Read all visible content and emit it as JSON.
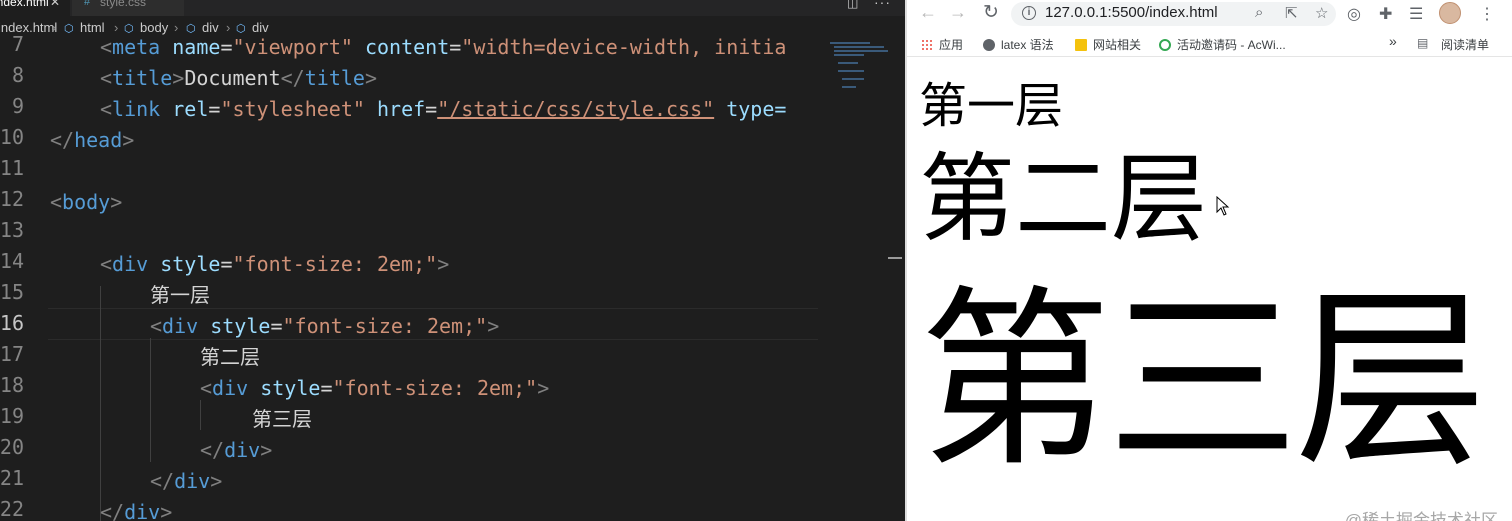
{
  "editor": {
    "tabs": [
      {
        "label": "index.html",
        "icon": "close-icon"
      },
      {
        "label": "style.css",
        "icon": "css-hash-icon"
      }
    ],
    "breadcrumb": [
      "index.html",
      "html",
      "body",
      "div",
      "div"
    ],
    "line_numbers": [
      "7",
      "8",
      "9",
      "10",
      "11",
      "12",
      "13",
      "14",
      "15",
      "16",
      "17",
      "18",
      "19",
      "20",
      "21",
      "22"
    ],
    "active_line": "16",
    "lines": {
      "l7": {
        "tag": "meta",
        "a1": "name",
        "v1": "\"viewport\"",
        "a2": "content",
        "v2": "\"width=device-width, initia"
      },
      "l8": {
        "open": "title",
        "text": "Document",
        "close": "title"
      },
      "l9": {
        "tag": "link",
        "a1": "rel",
        "v1": "\"stylesheet\"",
        "a2": "href",
        "v2": "\"/static/css/style.css\"",
        "a3": "type="
      },
      "l10": {
        "tag": "head"
      },
      "l12": {
        "tag": "body"
      },
      "l14": {
        "tag": "div",
        "attr": "style",
        "value": "\"font-size: 2em;\""
      },
      "l15": {
        "text": "第一层"
      },
      "l16": {
        "tag": "div",
        "attr": "style",
        "value": "\"font-size: 2em;\""
      },
      "l17": {
        "text": "第二层"
      },
      "l18": {
        "tag": "div",
        "attr": "style",
        "value": "\"font-size: 2em;\""
      },
      "l19": {
        "text": "第三层"
      },
      "l20": {
        "tag": "div"
      },
      "l21": {
        "tag": "div"
      },
      "l22": {
        "tag": "div"
      }
    }
  },
  "browser": {
    "url": "127.0.0.1:5500/index.html",
    "bookmarks": [
      {
        "label": "应用",
        "icon": "apps-grid-icon"
      },
      {
        "label": "latex 语法",
        "icon": "globe-icon"
      },
      {
        "label": "网站相关",
        "icon": "folder-icon"
      },
      {
        "label": "活动邀请码 - AcWi...",
        "icon": "acwing-icon"
      }
    ],
    "more_bookmarks": "»",
    "reading_list": "阅读清单",
    "page": {
      "layer1": "第一层",
      "layer2": "第二层",
      "layer3": "第三层"
    }
  },
  "watermark": "@稀土掘金技术社区",
  "colors": {
    "editor_bg": "#1e1e1e",
    "tag": "#569cd6",
    "attr": "#9cdcfe",
    "string": "#ce9178",
    "text": "#d4d4d4",
    "line_number": "#858585"
  }
}
